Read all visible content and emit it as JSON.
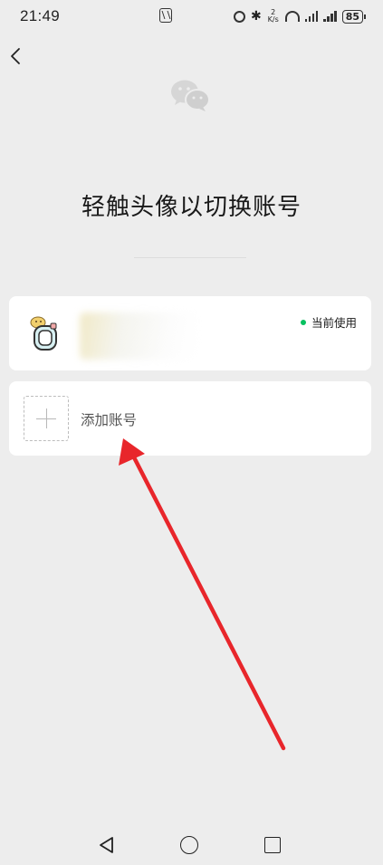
{
  "status_bar": {
    "time": "21:49",
    "speed_top": "2",
    "speed_unit": "K/s",
    "battery": "85",
    "icons": [
      "nfc-icon",
      "alarm-icon",
      "bluetooth-icon",
      "wifi-icon",
      "signal-icon",
      "signal-icon",
      "battery-icon"
    ]
  },
  "header": {
    "back_icon": "chevron-left-icon",
    "logo_icon": "wechat-logo-icon"
  },
  "main": {
    "title": "轻触头像以切换账号",
    "accounts": [
      {
        "name": "",
        "badge": "当前使用",
        "badge_color": "#07c160"
      }
    ],
    "add_account_label": "添加账号"
  },
  "annotation": {
    "arrow_color": "#e8262b"
  },
  "nav_bar": {
    "icons": [
      "nav-back-icon",
      "nav-home-icon",
      "nav-recents-icon"
    ]
  }
}
